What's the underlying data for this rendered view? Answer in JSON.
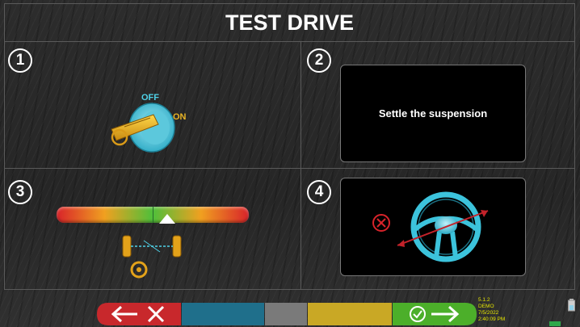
{
  "header": {
    "title": "TEST DRIVE"
  },
  "steps": [
    {
      "number": "1",
      "on_label": "ON",
      "off_label": "OFF"
    },
    {
      "number": "2",
      "message": "Settle the suspension"
    },
    {
      "number": "3"
    },
    {
      "number": "4"
    }
  ],
  "footer": {
    "version": "5.1.2",
    "mode": "DEMO",
    "date": "7/5/2022",
    "time": "2:40:09 PM",
    "buttons": [
      {
        "name": "back-cancel",
        "color": "#c8282c"
      },
      {
        "name": "blank-blue",
        "color": "#1f6f8b"
      },
      {
        "name": "blank-gray",
        "color": "#7a7a7a"
      },
      {
        "name": "blank-yellow",
        "color": "#c9a825"
      },
      {
        "name": "confirm-next",
        "color": "#4caf2a"
      }
    ]
  },
  "icons": [
    "ignition-key-icon",
    "steering-wheel-icon",
    "cancel-circle-icon",
    "back-arrow-icon",
    "close-x-icon",
    "check-circle-icon",
    "forward-arrow-icon",
    "battery-icon",
    "network-icon"
  ]
}
